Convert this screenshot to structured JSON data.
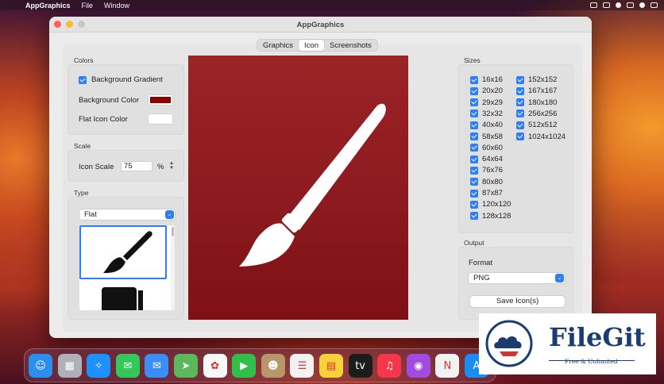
{
  "menubar": {
    "apple_icon": "apple-icon",
    "app_name": "AppGraphics",
    "items": [
      "File",
      "Window"
    ]
  },
  "window": {
    "title": "AppGraphics",
    "tabs": [
      {
        "label": "Graphics",
        "selected": false
      },
      {
        "label": "Icon",
        "selected": true
      },
      {
        "label": "Screenshots",
        "selected": false
      }
    ]
  },
  "colors_panel": {
    "section_label": "Colors",
    "background_gradient_label": "Background Gradient",
    "background_gradient_checked": true,
    "background_color_label": "Background Color",
    "background_color_value": "#8b0000",
    "flat_icon_color_label": "Flat Icon Color",
    "flat_icon_color_value": "#ffffff"
  },
  "scale_panel": {
    "section_label": "Scale",
    "icon_scale_label": "Icon Scale",
    "icon_scale_value": "75",
    "unit": "%"
  },
  "type_panel": {
    "section_label": "Type",
    "selected_type": "Flat",
    "items": [
      "brush-icon",
      "marker-icon"
    ]
  },
  "preview": {
    "icon": "paintbrush-icon",
    "gradient_top": "#9b2427",
    "gradient_bottom": "#7f1014"
  },
  "sizes_panel": {
    "section_label": "Sizes",
    "column1": [
      "16x16",
      "20x20",
      "29x29",
      "32x32",
      "40x40",
      "58x58",
      "60x60",
      "64x64",
      "76x76",
      "80x80",
      "87x87",
      "120x120",
      "128x128"
    ],
    "column2": [
      "152x152",
      "167x167",
      "180x180",
      "256x256",
      "512x512",
      "1024x1024"
    ],
    "all_checked": true
  },
  "output_panel": {
    "section_label": "Output",
    "format_label": "Format",
    "format_value": "PNG",
    "save_button_label": "Save Icon(s)"
  },
  "dock": {
    "apps": [
      {
        "name": "finder-icon",
        "color": "#2c8ef0",
        "glyph": "☺"
      },
      {
        "name": "launchpad-icon",
        "color": "#b0b0b8",
        "glyph": "▦"
      },
      {
        "name": "safari-icon",
        "color": "#1e90ff",
        "glyph": "✧"
      },
      {
        "name": "messages-icon",
        "color": "#34c759",
        "glyph": "✉"
      },
      {
        "name": "mail-icon",
        "color": "#3b8ef7",
        "glyph": "✉"
      },
      {
        "name": "maps-icon",
        "color": "#5cb85c",
        "glyph": "➤"
      },
      {
        "name": "photos-icon",
        "color": "#f7f7f7",
        "glyph": "✿"
      },
      {
        "name": "facetime-icon",
        "color": "#2fbf4a",
        "glyph": "▶"
      },
      {
        "name": "contacts-icon",
        "color": "#b8966a",
        "glyph": "☻"
      },
      {
        "name": "reminders-icon",
        "color": "#f2f2f2",
        "glyph": "☰"
      },
      {
        "name": "notes-icon",
        "color": "#f5d23b",
        "glyph": "▤"
      },
      {
        "name": "appletv-icon",
        "color": "#1c1c1c",
        "glyph": "tv"
      },
      {
        "name": "music-icon",
        "color": "#f5364b",
        "glyph": "♫"
      },
      {
        "name": "podcasts-icon",
        "color": "#a24be0",
        "glyph": "◉"
      },
      {
        "name": "news-icon",
        "color": "#f2f2f2",
        "glyph": "N"
      },
      {
        "name": "appstore-icon",
        "color": "#1a8cf5",
        "glyph": "A"
      }
    ]
  },
  "badge": {
    "brand": "FileGit",
    "tagline": "Free & Unlimited",
    "logo_icon": "cloud-logo-icon"
  }
}
